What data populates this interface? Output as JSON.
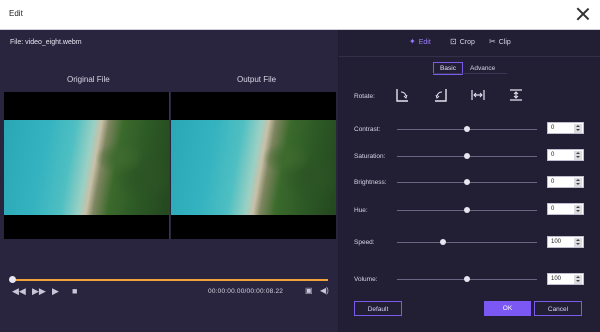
{
  "window": {
    "title": "Edit"
  },
  "preview": {
    "file_label": "File: video_eight.webm",
    "original_label": "Original File",
    "output_label": "Output File",
    "timecode": "00:00:00.00/00:00:08.22",
    "progress_percent": 0
  },
  "tabs": [
    {
      "label": "Edit",
      "icon": "wand-icon",
      "active": true
    },
    {
      "label": "Crop",
      "icon": "crop-icon",
      "active": false
    },
    {
      "label": "Clip",
      "icon": "scissors-icon",
      "active": false
    }
  ],
  "subtabs": {
    "basic": "Basic",
    "advance": "Advance"
  },
  "rotate": {
    "label": "Rotate:"
  },
  "adjustments": {
    "contrast": {
      "label": "Contrast:",
      "value": "0",
      "level_percent": 50
    },
    "saturation": {
      "label": "Saturation:",
      "value": "0",
      "level_percent": 50
    },
    "brightness": {
      "label": "Brightness:",
      "value": "0",
      "level_percent": 50
    },
    "hue": {
      "label": "Hue:",
      "value": "0",
      "level_percent": 50
    },
    "speed": {
      "label": "Speed:",
      "value": "100",
      "level_percent": 33
    },
    "volume": {
      "label": "Volume:",
      "value": "100",
      "level_percent": 50
    }
  },
  "buttons": {
    "default": "Default",
    "ok": "OK",
    "cancel": "Cancel"
  },
  "colors": {
    "accent": "#7b57f4",
    "progress": "#f2a03b"
  }
}
